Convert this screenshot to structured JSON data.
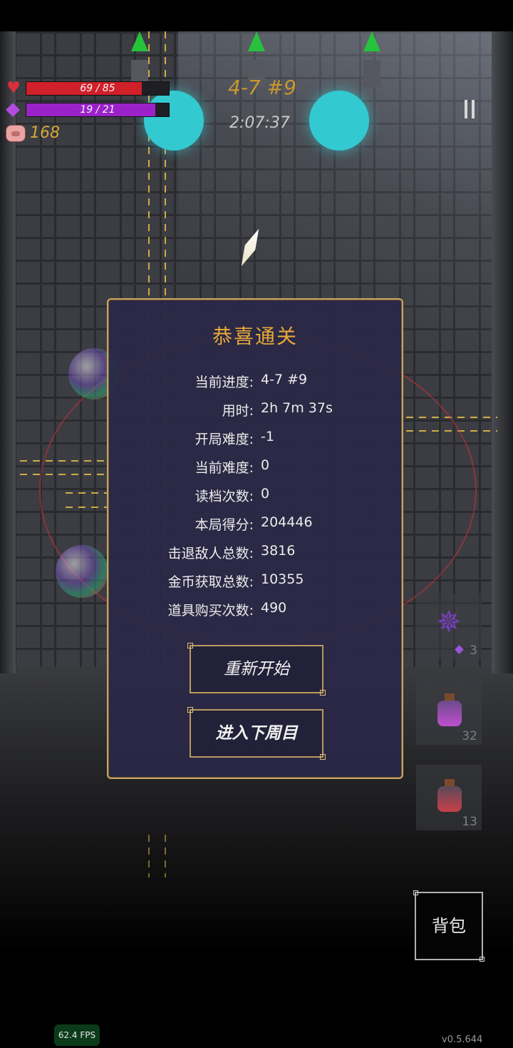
{
  "hud": {
    "hp_text": "69 / 85",
    "hp_current": 69,
    "hp_max": 85,
    "mp_text": "19 / 21",
    "mp_current": 19,
    "mp_max": 21,
    "coins": "168",
    "level": "4-7 #9",
    "timer": "2:07:37",
    "colors": {
      "hp": "#d0202a",
      "mp": "#9a22c8",
      "coins": "#d6a83a",
      "level": "#c8972e"
    },
    "icons": {
      "hp": "heart-icon",
      "mp": "diamond-icon",
      "coins": "pig-icon",
      "pause": "pause-icon"
    }
  },
  "dialog": {
    "title": "恭喜通关",
    "stats": [
      {
        "label": "当前进度:",
        "value": "4-7 #9"
      },
      {
        "label": "用时:",
        "value": "2h 7m 37s"
      },
      {
        "label": "开局难度:",
        "value": "-1"
      },
      {
        "label": "当前难度:",
        "value": "0"
      },
      {
        "label": "读档次数:",
        "value": "0"
      },
      {
        "label": "本局得分:",
        "value": "204446"
      },
      {
        "label": "击退敌人总数:",
        "value": "3816"
      },
      {
        "label": "金币获取总数:",
        "value": "10355"
      },
      {
        "label": "道具购买次数:",
        "value": "490"
      }
    ],
    "restart_label": "重新开始",
    "next_cycle_label": "进入下周目",
    "accent_color": "#e8a83a",
    "border_color": "#c9a561"
  },
  "items": [
    {
      "icon": "shuriken-icon",
      "count": "3"
    },
    {
      "icon": "purple-potion-icon",
      "count": "32"
    },
    {
      "icon": "red-potion-icon",
      "count": "13"
    }
  ],
  "bag_label": "背包",
  "fps": "62.4 FPS",
  "version": "v0.5.644"
}
